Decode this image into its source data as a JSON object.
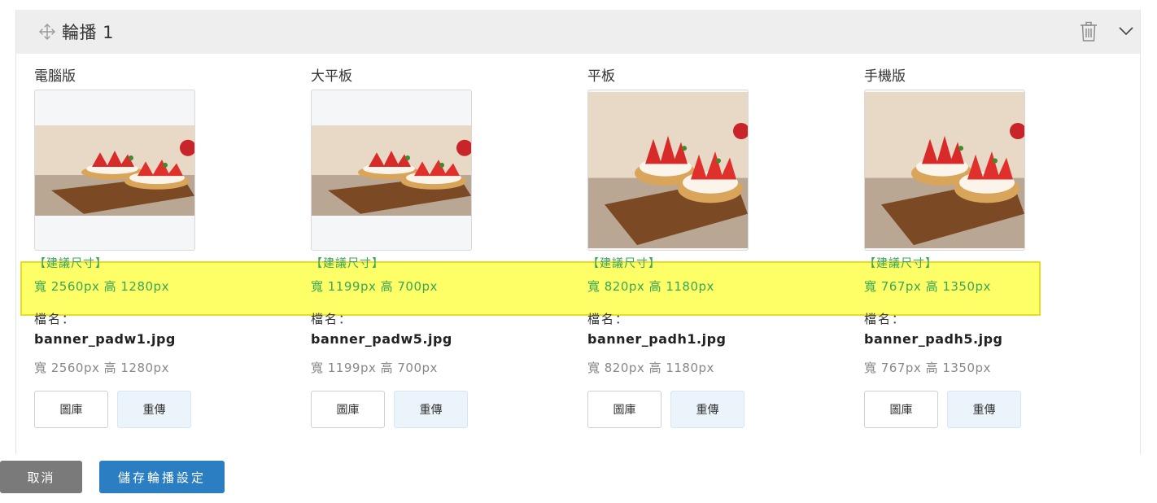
{
  "carousel": {
    "title": "輪播 1",
    "colors": {
      "header_bg": "#eeeeee",
      "highlight": "#fefe66",
      "suggest_text": "#3aa657",
      "save_button": "#2b7ec1",
      "cancel_button": "#7a7a7a"
    }
  },
  "columns": [
    {
      "label": "電腦版",
      "image_icon": "strawberry-tart-photo",
      "suggest_title": "【建議尺寸】",
      "suggest_size": "寬 2560px 高 1280px",
      "filename_label": "檔名：",
      "filename": "banner_padw1.jpg",
      "file_size": "寬 2560px 高 1280px",
      "gallery_label": "圖庫",
      "reupload_label": "重傳"
    },
    {
      "label": "大平板",
      "image_icon": "strawberry-tart-photo",
      "suggest_title": "【建議尺寸】",
      "suggest_size": "寬 1199px 高 700px",
      "filename_label": "檔名：",
      "filename": "banner_padw5.jpg",
      "file_size": "寬 1199px 高 700px",
      "gallery_label": "圖庫",
      "reupload_label": "重傳"
    },
    {
      "label": "平板",
      "image_icon": "strawberry-tart-photo",
      "suggest_title": "【建議尺寸】",
      "suggest_size": "寬 820px 高 1180px",
      "filename_label": "檔名：",
      "filename": "banner_padh1.jpg",
      "file_size": "寬 820px 高 1180px",
      "gallery_label": "圖庫",
      "reupload_label": "重傳"
    },
    {
      "label": "手機版",
      "image_icon": "strawberry-tart-photo",
      "suggest_title": "【建議尺寸】",
      "suggest_size": "寬 767px 高 1350px",
      "filename_label": "檔名：",
      "filename": "banner_padh5.jpg",
      "file_size": "寬 767px 高 1350px",
      "gallery_label": "圖庫",
      "reupload_label": "重傳"
    }
  ],
  "footer": {
    "cancel_label": "取消",
    "save_label": "儲存輪播設定"
  }
}
